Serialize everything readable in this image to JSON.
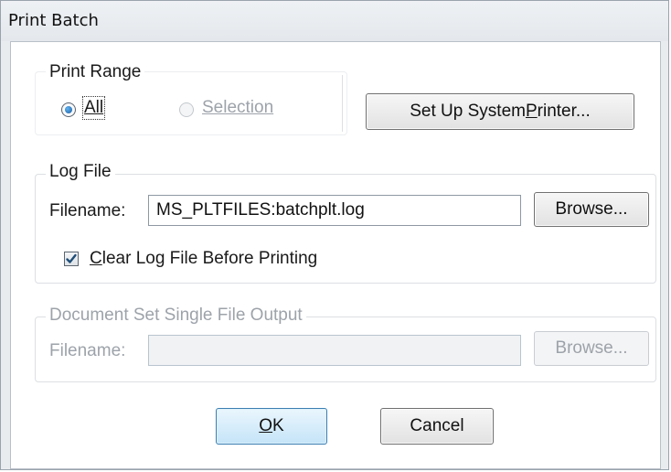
{
  "window": {
    "title": "Print Batch"
  },
  "print_range": {
    "label": "Print Range",
    "all_label": "All",
    "selection_label": "Selection",
    "all_selected": true
  },
  "setup_printer": {
    "label_pre": "Set Up System ",
    "label_key": "P",
    "label_post": "rinter..."
  },
  "log_file": {
    "label": "Log File",
    "filename_label": "Filename:",
    "filename_value": "MS_PLTFILES:batchplt.log",
    "browse_label": "Browse...",
    "clear_key": "C",
    "clear_rest": "lear Log File Before Printing",
    "clear_checked": true
  },
  "doc_set": {
    "label": "Document Set Single File Output",
    "filename_label": "Filename:",
    "filename_value": "",
    "browse_label": "Browse..."
  },
  "buttons": {
    "ok_key": "O",
    "ok_rest": "K",
    "cancel": "Cancel"
  },
  "colors": {
    "accent": "#3c7fb1",
    "disabled_text": "#9da3aa"
  }
}
